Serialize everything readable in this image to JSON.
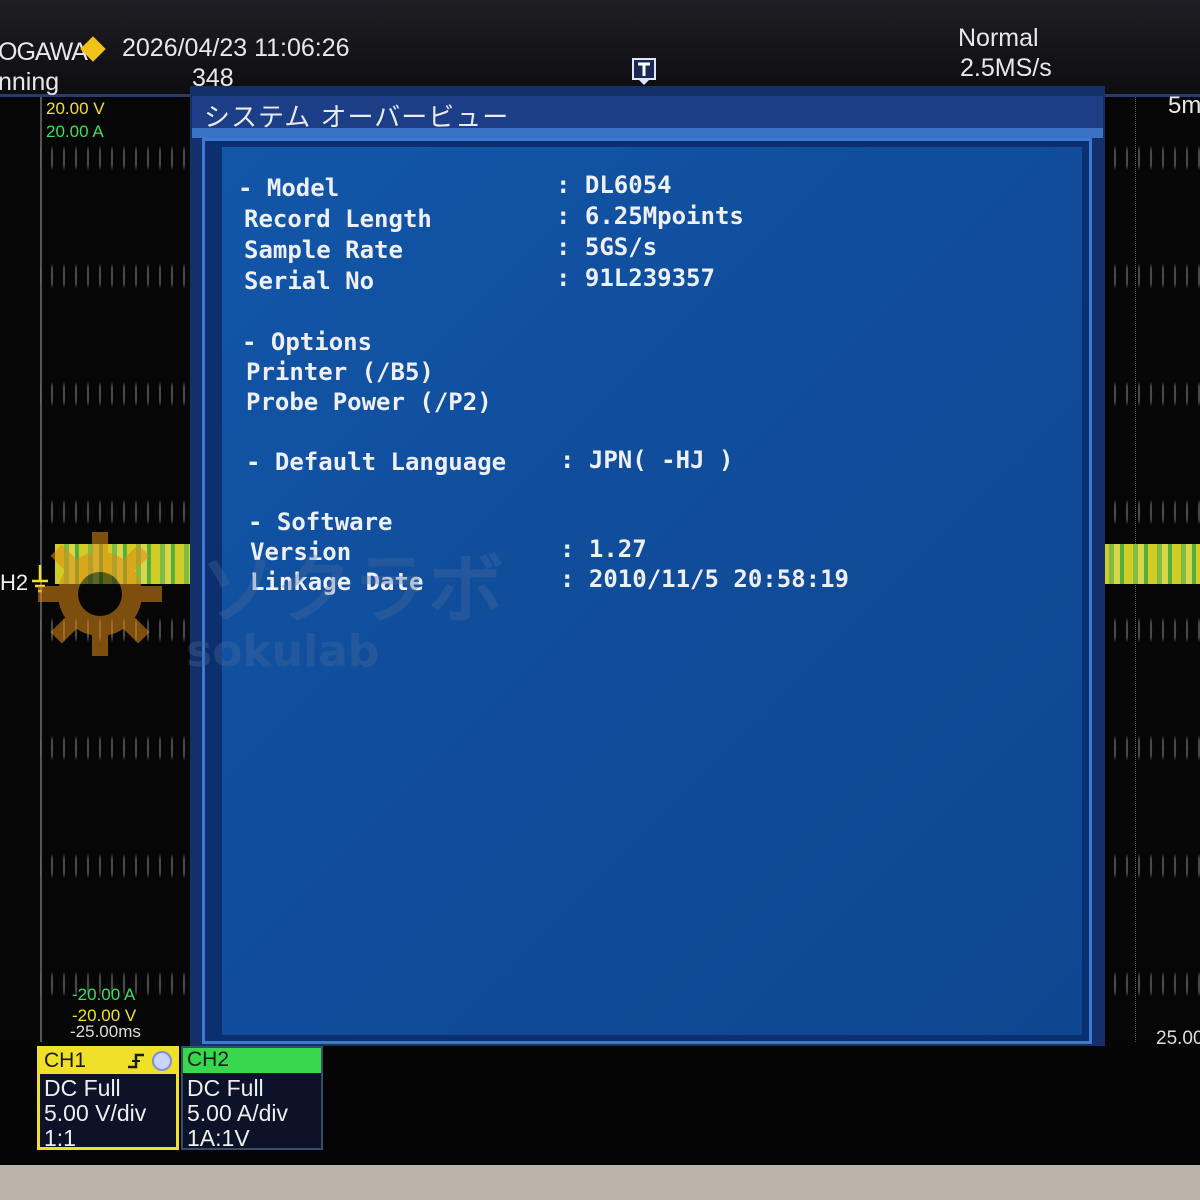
{
  "header": {
    "brand": "OGAWA",
    "datetime": "2026/04/23 11:06:26",
    "status": "nning",
    "acq_count": "348",
    "mode": "Normal",
    "sample_rate": "2.5MS/s",
    "time_div_partial": "5m"
  },
  "scale": {
    "ch1_top": "20.00 V",
    "ch2_top": "20.00 A",
    "ch2_bottom": "-20.00 A",
    "ch1_bottom": "-20.00 V",
    "time_left": "-25.00ms",
    "time_right": "25.00",
    "ch2_marker": "H2"
  },
  "watermark": {
    "jp": "ソクラボ",
    "en": "sokulab"
  },
  "dialog": {
    "title": "システム オーバービュー",
    "rows": [
      {
        "label": "- Model",
        "value": ": DL6054"
      },
      {
        "label": "  Record Length",
        "value": ": 6.25Mpoints"
      },
      {
        "label": "  Sample Rate",
        "value": ": 5GS/s"
      },
      {
        "label": "  Serial No",
        "value": ": 91L239357"
      },
      {
        "label": "- Options",
        "value": ""
      },
      {
        "label": "  Printer (/B5)",
        "value": ""
      },
      {
        "label": "  Probe Power (/P2)",
        "value": ""
      },
      {
        "label": "- Default Language",
        "value": ": JPN( -HJ )"
      },
      {
        "label": "- Software",
        "value": ""
      },
      {
        "label": "  Version",
        "value": ": 1.27"
      },
      {
        "label": "  Linkage Date",
        "value": ": 2010/11/5 20:58:19"
      }
    ]
  },
  "channels": {
    "ch1": {
      "title": "CH1",
      "coupling": "DC Full",
      "vdiv": "5.00 V/div",
      "probe": "1:1"
    },
    "ch2": {
      "title": "CH2",
      "coupling": "DC Full",
      "vdiv": "5.00 A/div",
      "probe": "1A:1V"
    }
  },
  "colors": {
    "ch1": "#f0e02a",
    "ch2": "#38d84e",
    "dialog_bg": "#1256a8",
    "accent": "#f2c21a"
  }
}
